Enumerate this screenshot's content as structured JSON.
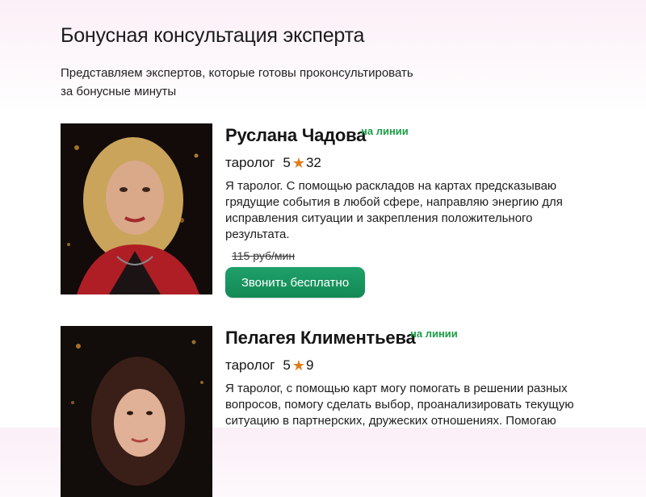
{
  "header": {
    "title": "Бонусная консультация эксперта",
    "subtitle_line1": "Представляем экспертов, которые готовы проконсультировать",
    "subtitle_line2": "за бонусные минуты"
  },
  "experts": [
    {
      "name": "Руслана Чадова",
      "status": "на линии",
      "role": "таролог",
      "rating": "5",
      "reviews": "32",
      "description": "Я таролог. С помощью раскладов на картах предсказываю грядущие события в любой сфере, направляю энергию для исправления ситуации и закрепления положительного результата.",
      "old_price": "115 руб/мин",
      "button_label": "Звонить бесплатно"
    },
    {
      "name": "Пелагея Климентьева",
      "status": "на линии",
      "role": "таролог",
      "rating": "5",
      "reviews": "9",
      "description": "Я таролог, с помощью карт могу помогать в решении разных вопросов, помогу сделать выбор, проанализировать текущую ситуацию в партнерских, дружеских отношениях. Помогаю"
    }
  ],
  "colors": {
    "online": "#1a9e45",
    "star": "#e07b1a",
    "button": "#178f5b"
  },
  "icons": {
    "rating": "star-icon"
  }
}
